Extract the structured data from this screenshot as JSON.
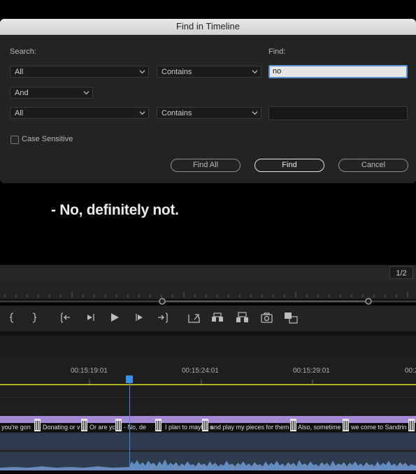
{
  "dialog": {
    "title": "Find in Timeline",
    "search_label": "Search:",
    "find_label": "Find:",
    "row1": {
      "field": "All",
      "operator": "Contains",
      "value": "no"
    },
    "conjunction": "And",
    "row2": {
      "field": "All",
      "operator": "Contains",
      "value": ""
    },
    "case_sensitive_label": "Case Sensitive",
    "case_sensitive_checked": false,
    "find_all_label": "Find All",
    "find_label_btn": "Find",
    "cancel_label": "Cancel"
  },
  "monitor": {
    "caption": "- No, definitely not.",
    "page_indicator": "1/2"
  },
  "timeline": {
    "timecodes": [
      "00:15:19:01",
      "00:15:24:01",
      "00:15:29:01",
      "00:2"
    ],
    "captions": [
      "you're gon",
      "Donating or v",
      "Or are yc",
      "- No, de",
      "I plan to maybe s",
      "and play my pieces for them",
      "Also, sometime",
      "we come to Sandrin"
    ],
    "colors": {
      "playhead": "#3b8fe8",
      "workarea": "#e8e01d",
      "caption_track": "#a48ad6",
      "audio": "#6f9bd0"
    }
  }
}
